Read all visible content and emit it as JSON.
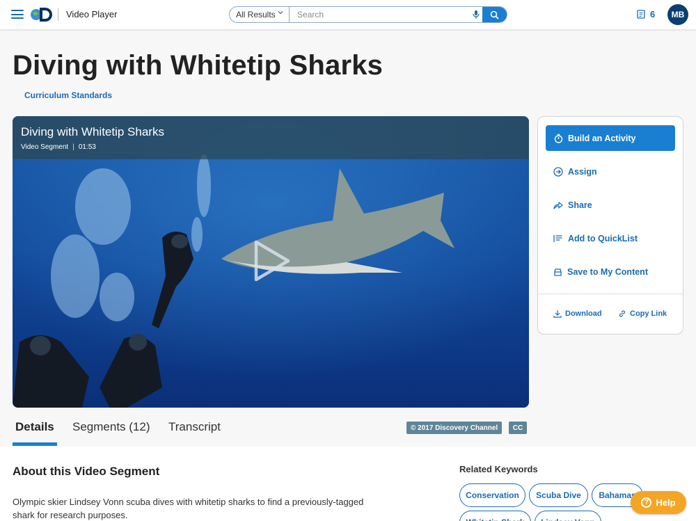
{
  "header": {
    "app_title": "Video Player",
    "search_scope": "All Results",
    "search_placeholder": "Search",
    "quicklist_count": "6",
    "avatar_initials": "MB"
  },
  "page": {
    "title": "Diving with Whitetip Sharks",
    "curriculum_link": "Curriculum Standards"
  },
  "video": {
    "title": "Diving with Whitetip Sharks",
    "type": "Video Segment",
    "separator": "|",
    "duration": "01:53"
  },
  "actions": {
    "build": "Build an Activity",
    "assign": "Assign",
    "share": "Share",
    "quicklist": "Add to QuickList",
    "save": "Save to My Content",
    "download": "Download",
    "copy_link": "Copy Link"
  },
  "tabs": {
    "details": "Details",
    "segments": "Segments (12)",
    "transcript": "Transcript"
  },
  "badges": {
    "copyright": "© 2017 Discovery Channel",
    "cc": "CC"
  },
  "about": {
    "title": "About this Video Segment",
    "description": "Olympic skier Lindsey Vonn scuba dives with whitetip sharks to find a previously-tagged shark for research purposes."
  },
  "keywords": {
    "title": "Related Keywords",
    "items": [
      "Conservation",
      "Scuba Dive",
      "Bahamas",
      "Whitetip Shark",
      "Lindsey Vonn"
    ]
  },
  "help": {
    "label": "Help"
  },
  "colors": {
    "accent": "#1a7fd1",
    "link": "#1a6bb5",
    "avatar": "#0b3f73",
    "help": "#f5a524",
    "badge": "#5f8598"
  }
}
